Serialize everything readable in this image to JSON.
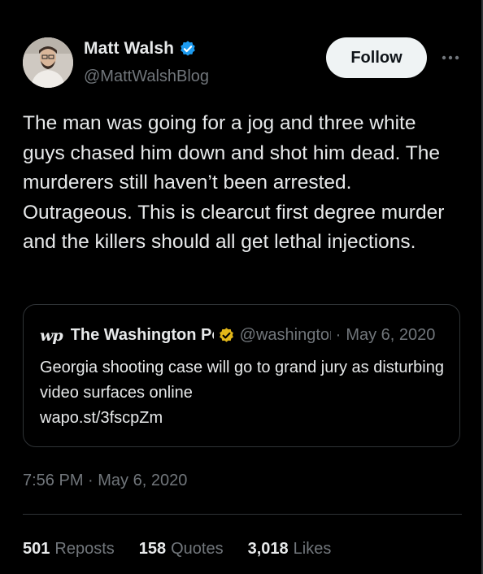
{
  "author": {
    "name": "Matt Walsh",
    "handle": "@MattWalshBlog",
    "verified_icon": "verified-badge-icon",
    "badge_color": "#1d9bf0"
  },
  "actions": {
    "follow_label": "Follow",
    "more_icon": "more-horizontal-icon"
  },
  "tweet": {
    "text": "The man was going for a jog and three white guys chased him down and shot him dead. The murderers still haven’t been arrested. Outrageous. This is clearcut first degree murder and the killers should all get lethal injections."
  },
  "quote": {
    "logo_text": "wp",
    "name": "The Washington Post",
    "badge_color": "#e2b719",
    "handle": "@washingtonpost",
    "separator": "·",
    "date": "May 6, 2020",
    "text": "Georgia shooting case will go to grand jury as disturbing video surfaces online\nwapo.st/3fscpZm"
  },
  "timestamp": "7:56 PM · May 6, 2020",
  "stats": {
    "reposts_count": "501",
    "reposts_label": "Reposts",
    "quotes_count": "158",
    "quotes_label": "Quotes",
    "likes_count": "3,018",
    "likes_label": "Likes"
  },
  "colors": {
    "background": "#000000",
    "text_primary": "#e7e9ea",
    "text_secondary": "#71767b",
    "border": "#2f3336"
  }
}
